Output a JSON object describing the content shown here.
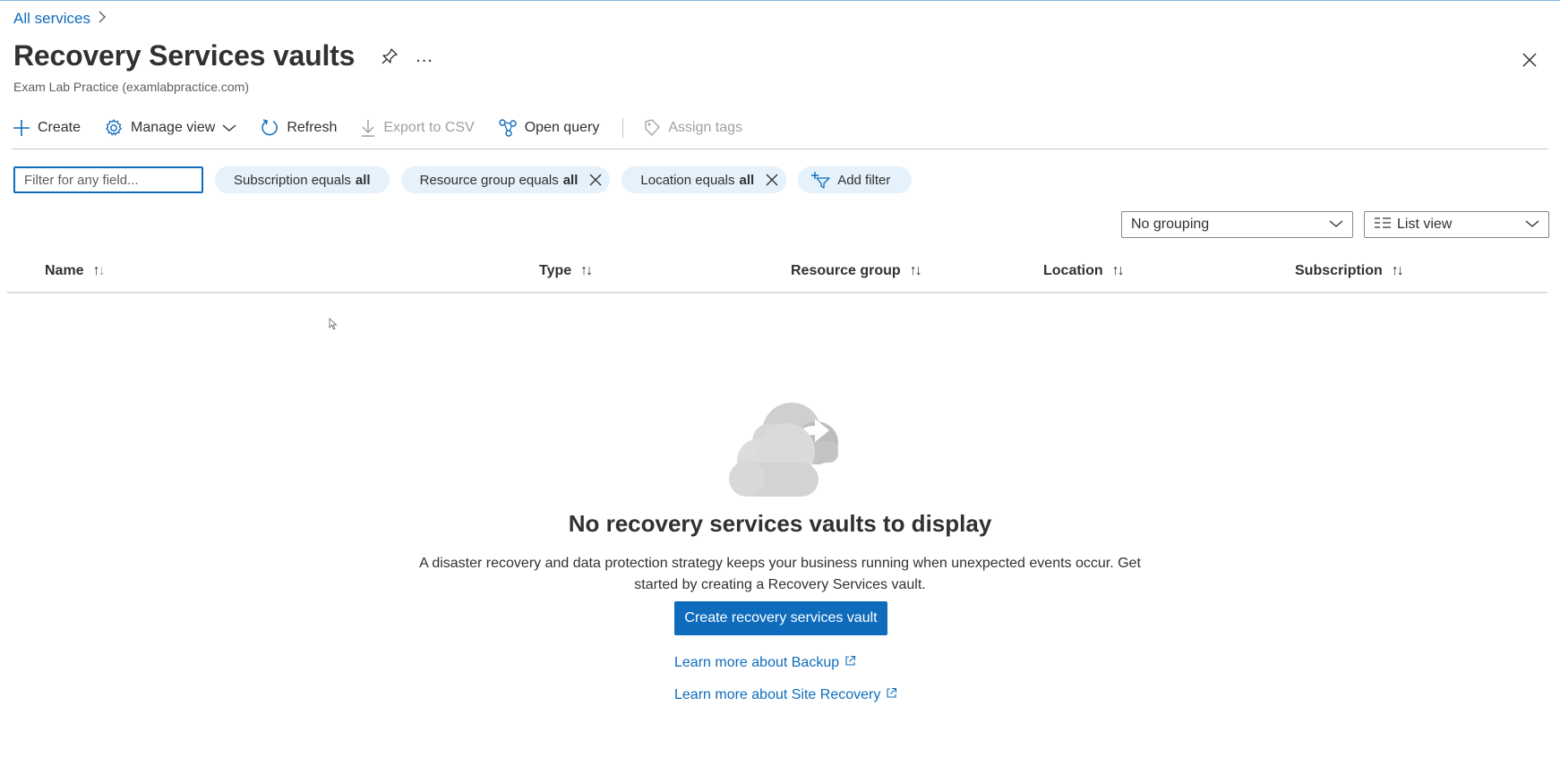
{
  "breadcrumb": {
    "root": "All services",
    "separator": ">"
  },
  "header": {
    "title": "Recovery Services vaults",
    "subtitle": "Exam Lab Practice (examlabpractice.com)",
    "more": "..."
  },
  "toolbar": {
    "create": "Create",
    "manage_view": "Manage view",
    "refresh": "Refresh",
    "export_csv": "Export to CSV",
    "open_query": "Open query",
    "assign_tags": "Assign tags"
  },
  "filters": {
    "search_placeholder": "Filter for any field...",
    "subscription": {
      "label": "Subscription equals",
      "value": "all"
    },
    "resource_group": {
      "label": "Resource group equals",
      "value": "all"
    },
    "location": {
      "label": "Location equals",
      "value": "all"
    },
    "add_filter": "Add filter"
  },
  "view_controls": {
    "grouping": "No grouping",
    "view": "List view"
  },
  "table": {
    "columns": [
      "Name",
      "Type",
      "Resource group",
      "Location",
      "Subscription"
    ]
  },
  "empty_state": {
    "title": "No recovery services vaults to display",
    "description": "A disaster recovery and data protection strategy keeps your business running when unexpected events occur. Get started by creating a Recovery Services vault.",
    "cta": "Create recovery services vault",
    "link_backup": "Learn more about Backup",
    "link_site_recovery": "Learn more about Site Recovery"
  },
  "colors": {
    "accent": "#0f6cbd",
    "pill_background": "#e5f1fb",
    "text": "#323130",
    "disabled": "#a19f9d"
  }
}
